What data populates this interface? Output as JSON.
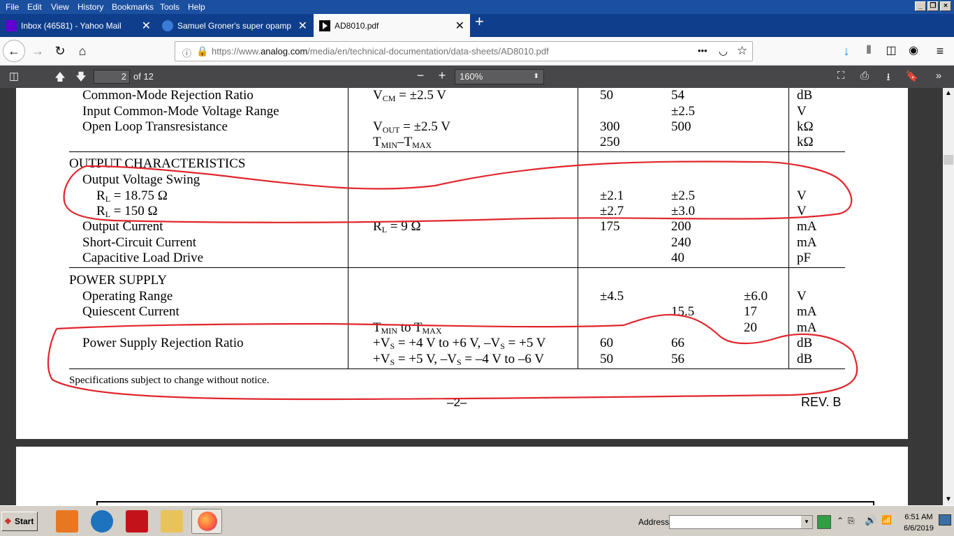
{
  "menubar": {
    "items": [
      "File",
      "Edit",
      "View",
      "History",
      "Bookmarks",
      "Tools",
      "Help"
    ]
  },
  "tabs": [
    {
      "label": "Inbox (46581) - Yahoo Mail",
      "active": false
    },
    {
      "label": "Samuel Groner's super opamp - Pa",
      "active": false
    },
    {
      "label": "AD8010.pdf",
      "active": true
    }
  ],
  "nav": {
    "url_prefix": "https://www.",
    "url_domain": "analog.com",
    "url_path": "/media/en/technical-documentation/data-sheets/AD8010.pdf",
    "menu_dots": "•••"
  },
  "pdf_toolbar": {
    "page_number": "2",
    "page_count": "of 12",
    "zoom_out": "−",
    "zoom_in": "+",
    "zoom_level": "160%"
  },
  "document": {
    "rows": [
      {
        "param": "Common-Mode Rejection Ratio",
        "cond_html": "V<sub>CM</sub> = ±2.5 V",
        "min": "50",
        "typ": "54",
        "max": "",
        "unit": "dB"
      },
      {
        "param": "Input Common-Mode Voltage Range",
        "cond_html": "",
        "min": "",
        "typ": "±2.5",
        "max": "",
        "unit": "V"
      },
      {
        "param": "Open Loop Transresistance",
        "cond_html": "V<sub>OUT</sub> = ±2.5 V",
        "min": "300",
        "typ": "500",
        "max": "",
        "unit": "kΩ"
      },
      {
        "param": "",
        "cond_html": "T<sub>MIN</sub>–T<sub>MAX</sub>",
        "min": "250",
        "typ": "",
        "max": "",
        "unit": "kΩ"
      },
      {
        "section": "OUTPUT CHARACTERISTICS"
      },
      {
        "param": "Output Voltage Swing",
        "cond_html": "",
        "min": "",
        "typ": "",
        "max": "",
        "unit": ""
      },
      {
        "param_html": "R<sub>L</sub> = 18.75 Ω",
        "indent": 2,
        "cond_html": "",
        "min": "±2.1",
        "typ": "±2.5",
        "max": "",
        "unit": "V"
      },
      {
        "param_html": "R<sub>L</sub> = 150 Ω",
        "indent": 2,
        "cond_html": "",
        "min": "±2.7",
        "typ": "±3.0",
        "max": "",
        "unit": "V"
      },
      {
        "param": "Output Current",
        "cond_html": "R<sub>L</sub> = 9 Ω",
        "min": "175",
        "typ": "200",
        "max": "",
        "unit": "mA"
      },
      {
        "param": "Short-Circuit Current",
        "cond_html": "",
        "min": "",
        "typ": "240",
        "max": "",
        "unit": "mA"
      },
      {
        "param": "Capacitive Load Drive",
        "cond_html": "",
        "min": "",
        "typ": "40",
        "max": "",
        "unit": "pF"
      },
      {
        "section": "POWER SUPPLY"
      },
      {
        "param": "Operating Range",
        "cond_html": "",
        "min": "±4.5",
        "typ": "",
        "max": "±6.0",
        "unit": "V"
      },
      {
        "param": "Quiescent Current",
        "cond_html": "",
        "min": "",
        "typ": "15.5",
        "max": "17",
        "unit": "mA"
      },
      {
        "param": "",
        "cond_html": "T<sub>MIN</sub> to T<sub>MAX</sub>",
        "min": "",
        "typ": "",
        "max": "20",
        "unit": "mA"
      },
      {
        "param": "Power Supply Rejection Ratio",
        "cond_html": "+V<sub>S</sub> = +4 V to +6 V, –V<sub>S</sub> = +5 V",
        "min": "60",
        "typ": "66",
        "max": "",
        "unit": "dB"
      },
      {
        "param": "",
        "cond_html": "+V<sub>S</sub> = +5 V, –V<sub>S</sub> = –4 V to –6 V",
        "min": "50",
        "typ": "56",
        "max": "",
        "unit": "dB"
      }
    ],
    "footnote": "Specifications subject to change without notice.",
    "page_label": "–2–",
    "revision": "REV. B",
    "annotation_color": "#e0262c"
  },
  "taskbar": {
    "start_label": "Start",
    "address_label": "Address",
    "clock_time": "6:51 AM",
    "clock_date": "6/6/2019"
  },
  "icons": {
    "back": "arrow-left-icon",
    "forward": "arrow-right-icon",
    "reload": "reload-icon",
    "home": "home-icon",
    "download": "download-icon",
    "library": "library-icon",
    "sidebar": "sidebar-icon",
    "account": "account-icon",
    "menu": "hamburger-icon"
  }
}
